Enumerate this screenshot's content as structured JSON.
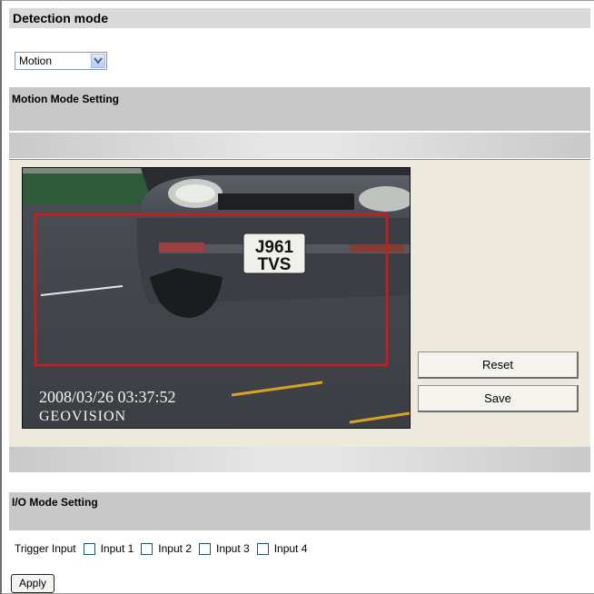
{
  "detection": {
    "title": "Detection mode",
    "mode_value": "Motion"
  },
  "motion": {
    "title": "Motion Mode Setting",
    "video": {
      "plate_line1": "J961",
      "plate_line2": "TVS",
      "timestamp": "2008/03/26 03:37:52",
      "brand": "GEOVISION"
    },
    "reset_label": "Reset",
    "save_label": "Save"
  },
  "io": {
    "title": "I/O Mode Setting",
    "trigger_label": "Trigger Input",
    "inputs": [
      "Input 1",
      "Input 2",
      "Input 3",
      "Input 4"
    ]
  },
  "apply_label": "Apply",
  "colors": {
    "detection_zone": "#d11a1a",
    "panel_bg": "#ede9dc",
    "header_bg": "#c8c8c8"
  }
}
